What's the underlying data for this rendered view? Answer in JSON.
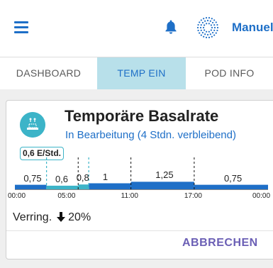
{
  "header": {
    "mode_label": "Manuell",
    "menu_icon": "hamburger-menu-icon",
    "bell_icon": "bell-icon",
    "status_icon": "pod-status-icon",
    "accent_color": "#1e6fc7"
  },
  "tabs": [
    {
      "label": "DASHBOARD",
      "active": false
    },
    {
      "label": "TEMP EIN",
      "active": true
    },
    {
      "label": "POD INFO",
      "active": false
    }
  ],
  "card": {
    "title": "Temporäre Basalrate",
    "subtitle": "In Bearbeitung (4 Stdn. verbleibend)",
    "current_rate": "0,6 E/Std.",
    "reduction_label": "Verring.",
    "reduction_value": "20%",
    "cancel_label": "ABBRECHEN"
  },
  "chart_data": {
    "type": "bar",
    "segments": [
      {
        "label": "0,75",
        "start": "00:00",
        "end": "03:00",
        "value": 0.75,
        "kind": "base"
      },
      {
        "label": "0,6",
        "start": "03:00",
        "end": "06:00",
        "value": 0.6,
        "kind": "temp"
      },
      {
        "label": "0,8",
        "start": "06:00",
        "end": "07:00",
        "value": 0.8,
        "kind": "temp"
      },
      {
        "label": "1",
        "start": "07:00",
        "end": "11:00",
        "value": 1.0,
        "kind": "base"
      },
      {
        "label": "1,25",
        "start": "11:00",
        "end": "17:00",
        "value": 1.25,
        "kind": "base"
      },
      {
        "label": "0,75",
        "start": "17:00",
        "end": "24:00",
        "value": 0.75,
        "kind": "base"
      }
    ],
    "x_ticks": [
      "00:00",
      "05:00",
      "11:00",
      "17:00",
      "00:00"
    ],
    "colors": {
      "base": "#1e6fc7",
      "temp": "#3cb4c8"
    }
  }
}
